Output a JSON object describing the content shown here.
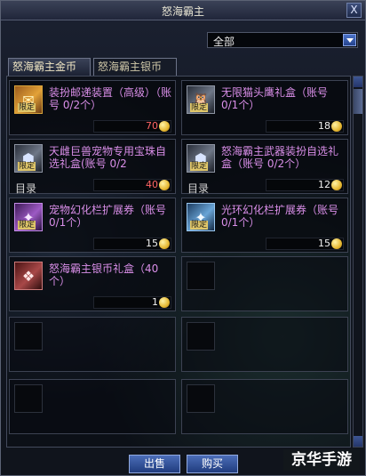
{
  "window": {
    "title": "怒海霸主",
    "close_glyph": "X"
  },
  "filter": {
    "selected": "全部"
  },
  "tabs": [
    {
      "label": "怒海霸主金币",
      "active": true
    },
    {
      "label": "怒海霸主银币",
      "active": false
    }
  ],
  "items": [
    {
      "name": "装扮邮递装置（高级）（账号 0/2个）",
      "price": "70",
      "price_color": "#ff6464",
      "badge": "限定",
      "icon": "gift-box-icon",
      "catalog": ""
    },
    {
      "name": "无限猫头鹰礼盒（账号 0/1个）",
      "price": "18",
      "price_color": "#ffffff",
      "badge": "限定",
      "icon": "owl-gift-icon",
      "catalog": ""
    },
    {
      "name": "天雌巨兽宠物专用宝珠自选礼盒(账号 0/2",
      "price": "40",
      "price_color": "#ff6464",
      "badge": "限定",
      "icon": "pet-orb-box-icon",
      "catalog": "目录"
    },
    {
      "name": "怒海霸主武器装扮自选礼盒（账号 0/2个）",
      "price": "12",
      "price_color": "#ffffff",
      "badge": "限定",
      "icon": "weapon-skin-box-icon",
      "catalog": "目录"
    },
    {
      "name": "宠物幻化栏扩展券（账号 0/1个）",
      "price": "15",
      "price_color": "#ffffff",
      "badge": "限定",
      "icon": "pet-ticket-icon",
      "catalog": ""
    },
    {
      "name": "光环幻化栏扩展券（账号 0/1个）",
      "price": "15",
      "price_color": "#ffffff",
      "badge": "限定",
      "icon": "aura-ticket-icon",
      "catalog": ""
    },
    {
      "name": "怒海霸主银币礼盒（40个）",
      "price": "1",
      "price_color": "#ffffff",
      "badge": "",
      "icon": "silver-coin-box-icon",
      "catalog": ""
    }
  ],
  "buttons": {
    "sell": "出售",
    "buy": "购买"
  },
  "watermark": "京华手游"
}
